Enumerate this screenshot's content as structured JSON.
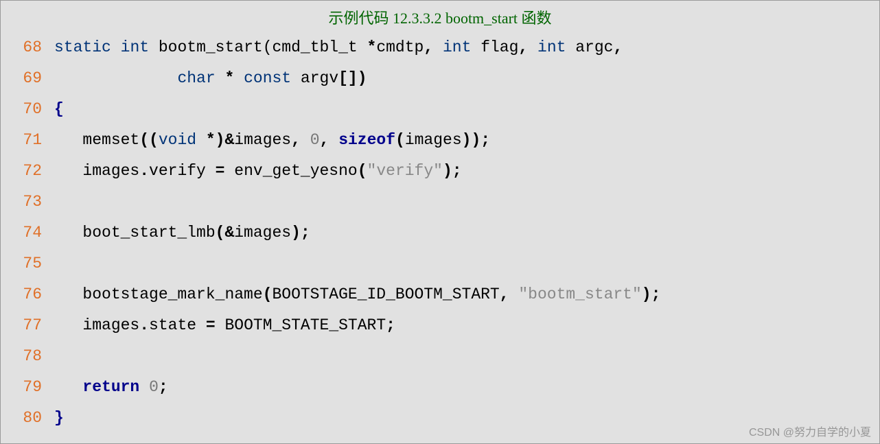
{
  "title": "示例代码 12.3.3.2 bootm_start 函数",
  "watermark": "CSDN @努力自学的小夏",
  "lines": {
    "l68": {
      "n": "68",
      "t": [
        {
          "c": "kw-type",
          "v": "static"
        },
        {
          "c": "",
          "v": " "
        },
        {
          "c": "kw-type",
          "v": "int"
        },
        {
          "c": "",
          "v": " bootm_start(cmd_tbl_t "
        },
        {
          "c": "op-bold",
          "v": "*"
        },
        {
          "c": "",
          "v": "cmdtp"
        },
        {
          "c": "op-bold",
          "v": ","
        },
        {
          "c": "",
          "v": " "
        },
        {
          "c": "kw-type",
          "v": "int"
        },
        {
          "c": "",
          "v": " flag"
        },
        {
          "c": "op-bold",
          "v": ","
        },
        {
          "c": "",
          "v": " "
        },
        {
          "c": "kw-type",
          "v": "int"
        },
        {
          "c": "",
          "v": " argc"
        },
        {
          "c": "op-bold",
          "v": ","
        }
      ]
    },
    "l69": {
      "n": "69",
      "t": [
        {
          "c": "",
          "v": "             "
        },
        {
          "c": "kw-type",
          "v": "char"
        },
        {
          "c": "",
          "v": " "
        },
        {
          "c": "op-bold",
          "v": "*"
        },
        {
          "c": "",
          "v": " "
        },
        {
          "c": "kw-type",
          "v": "const"
        },
        {
          "c": "",
          "v": " argv"
        },
        {
          "c": "op-bold",
          "v": "[])"
        }
      ]
    },
    "l70": {
      "n": "70",
      "t": [
        {
          "c": "brace",
          "v": "{"
        }
      ]
    },
    "l71": {
      "n": "71",
      "t": [
        {
          "c": "",
          "v": "   memset"
        },
        {
          "c": "op-bold",
          "v": "(("
        },
        {
          "c": "kw-type",
          "v": "void"
        },
        {
          "c": "",
          "v": " "
        },
        {
          "c": "op-bold",
          "v": "*)&"
        },
        {
          "c": "",
          "v": "images"
        },
        {
          "c": "op-bold",
          "v": ","
        },
        {
          "c": "",
          "v": " "
        },
        {
          "c": "num",
          "v": "0"
        },
        {
          "c": "op-bold",
          "v": ","
        },
        {
          "c": "",
          "v": " "
        },
        {
          "c": "kw-bold",
          "v": "sizeof"
        },
        {
          "c": "op-bold",
          "v": "("
        },
        {
          "c": "",
          "v": "images"
        },
        {
          "c": "op-bold",
          "v": "));"
        }
      ]
    },
    "l72": {
      "n": "72",
      "t": [
        {
          "c": "",
          "v": "   images"
        },
        {
          "c": "op-bold",
          "v": "."
        },
        {
          "c": "",
          "v": "verify "
        },
        {
          "c": "op-bold",
          "v": "="
        },
        {
          "c": "",
          "v": " env_get_yesno"
        },
        {
          "c": "op-bold",
          "v": "("
        },
        {
          "c": "str",
          "v": "\"verify\""
        },
        {
          "c": "op-bold",
          "v": ");"
        }
      ]
    },
    "l73": {
      "n": "73",
      "t": [
        {
          "c": "",
          "v": ""
        }
      ]
    },
    "l74": {
      "n": "74",
      "t": [
        {
          "c": "",
          "v": "   boot_start_lmb"
        },
        {
          "c": "op-bold",
          "v": "(&"
        },
        {
          "c": "",
          "v": "images"
        },
        {
          "c": "op-bold",
          "v": ");"
        }
      ]
    },
    "l75": {
      "n": "75",
      "t": [
        {
          "c": "",
          "v": ""
        }
      ]
    },
    "l76": {
      "n": "76",
      "t": [
        {
          "c": "",
          "v": "   bootstage_mark_name"
        },
        {
          "c": "op-bold",
          "v": "("
        },
        {
          "c": "",
          "v": "BOOTSTAGE_ID_BOOTM_START"
        },
        {
          "c": "op-bold",
          "v": ","
        },
        {
          "c": "",
          "v": " "
        },
        {
          "c": "str",
          "v": "\"bootm_start\""
        },
        {
          "c": "op-bold",
          "v": ");"
        }
      ]
    },
    "l77": {
      "n": "77",
      "t": [
        {
          "c": "",
          "v": "   images"
        },
        {
          "c": "op-bold",
          "v": "."
        },
        {
          "c": "",
          "v": "state "
        },
        {
          "c": "op-bold",
          "v": "="
        },
        {
          "c": "",
          "v": " BOOTM_STATE_START"
        },
        {
          "c": "op-bold",
          "v": ";"
        }
      ]
    },
    "l78": {
      "n": "78",
      "t": [
        {
          "c": "",
          "v": ""
        }
      ]
    },
    "l79": {
      "n": "79",
      "t": [
        {
          "c": "",
          "v": "   "
        },
        {
          "c": "kw-bold",
          "v": "return"
        },
        {
          "c": "",
          "v": " "
        },
        {
          "c": "num",
          "v": "0"
        },
        {
          "c": "op-bold",
          "v": ";"
        }
      ]
    },
    "l80": {
      "n": "80",
      "t": [
        {
          "c": "brace",
          "v": "}"
        }
      ]
    }
  },
  "order": [
    "l68",
    "l69",
    "l70",
    "l71",
    "l72",
    "l73",
    "l74",
    "l75",
    "l76",
    "l77",
    "l78",
    "l79",
    "l80"
  ]
}
